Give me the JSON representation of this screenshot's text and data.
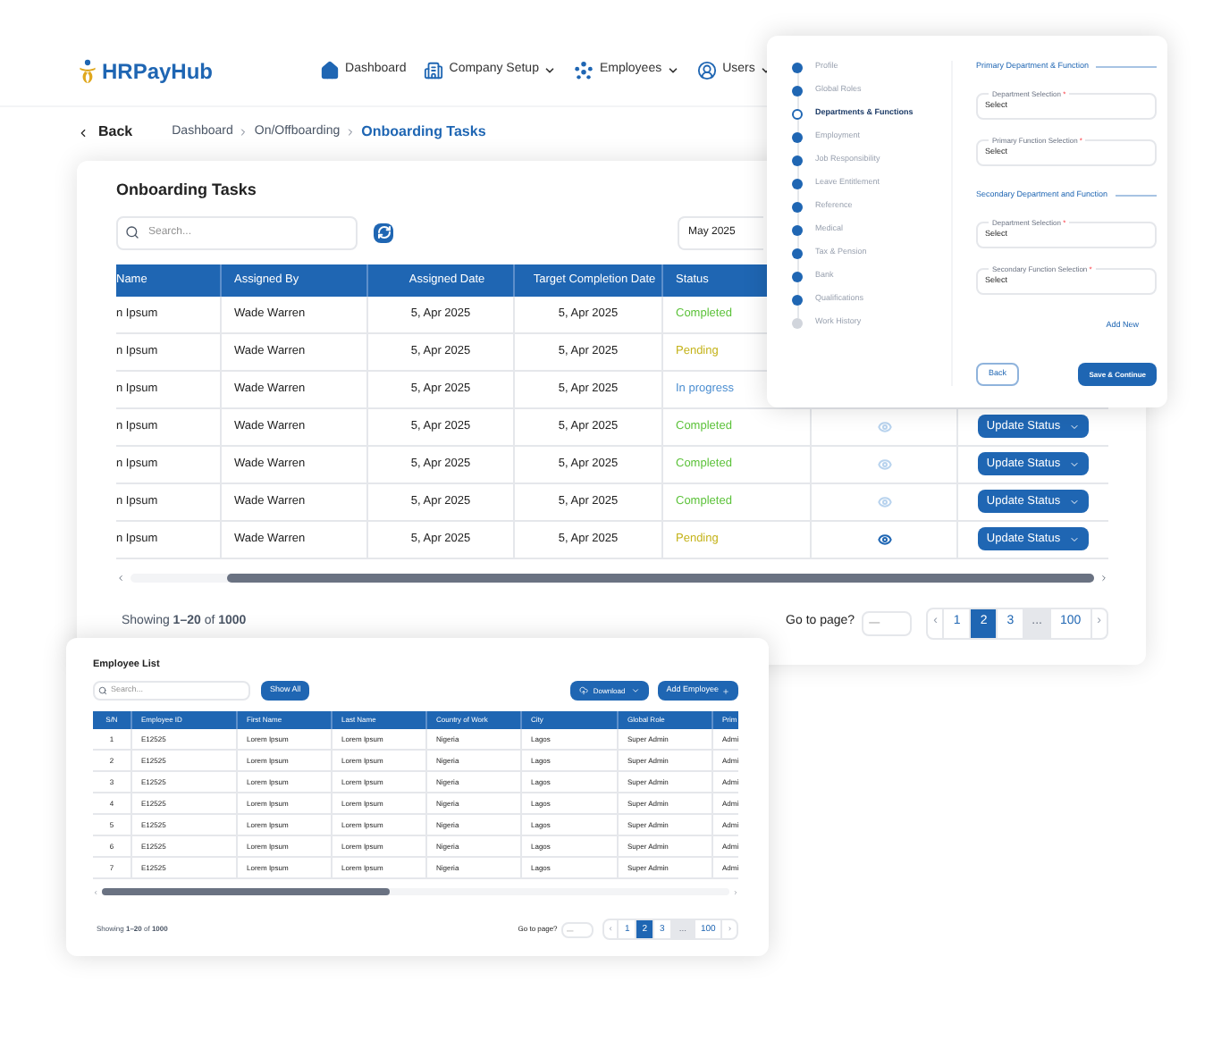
{
  "header": {
    "logo": "HRPayHub",
    "nav": [
      {
        "label": "Dashboard",
        "dropdown": false
      },
      {
        "label": "Company Setup",
        "dropdown": true
      },
      {
        "label": "Employees",
        "dropdown": true
      },
      {
        "label": "Users",
        "dropdown": true
      }
    ]
  },
  "breadcrumb": {
    "back": "Back",
    "items": [
      {
        "label": "Dashboard",
        "selected": false
      },
      {
        "label": "On/Offboarding",
        "selected": false
      },
      {
        "label": "Onboarding Tasks",
        "selected": true
      }
    ]
  },
  "onboarding": {
    "title": "Onboarding Tasks",
    "search_placeholder": "Search...",
    "month": "May 2025",
    "columns": [
      "Name",
      "Assigned By",
      "Assigned Date",
      "Target Completion Date",
      "Status"
    ],
    "rows": [
      {
        "name": "n Ipsum",
        "assigned_by": "Wade Warren",
        "assigned_date": "5, Apr 2025",
        "target_date": "5, Apr 2025",
        "status": "Completed",
        "kind": "completed"
      },
      {
        "name": "n Ipsum",
        "assigned_by": "Wade Warren",
        "assigned_date": "5, Apr 2025",
        "target_date": "5, Apr 2025",
        "status": "Pending",
        "kind": "pending"
      },
      {
        "name": "n Ipsum",
        "assigned_by": "Wade Warren",
        "assigned_date": "5, Apr 2025",
        "target_date": "5, Apr 2025",
        "status": "In progress",
        "kind": "progress"
      },
      {
        "name": "n Ipsum",
        "assigned_by": "Wade Warren",
        "assigned_date": "5, Apr 2025",
        "target_date": "5, Apr 2025",
        "status": "Completed",
        "kind": "completed",
        "eye_active": false,
        "action": "Update Status"
      },
      {
        "name": "n Ipsum",
        "assigned_by": "Wade Warren",
        "assigned_date": "5, Apr 2025",
        "target_date": "5, Apr 2025",
        "status": "Completed",
        "kind": "completed",
        "eye_active": false,
        "action": "Update Status"
      },
      {
        "name": "n Ipsum",
        "assigned_by": "Wade Warren",
        "assigned_date": "5, Apr 2025",
        "target_date": "5, Apr 2025",
        "status": "Completed",
        "kind": "completed",
        "eye_active": false,
        "action": "Update Status"
      },
      {
        "name": "n Ipsum",
        "assigned_by": "Wade Warren",
        "assigned_date": "5, Apr 2025",
        "target_date": "5, Apr 2025",
        "status": "Pending",
        "kind": "pending",
        "eye_active": true,
        "action": "Update Status"
      }
    ],
    "showing": "Showing **1–20** of **1000**",
    "goto_label": "Go to page?",
    "goto_placeholder": "—",
    "pages": [
      {
        "label": "‹",
        "kind": "arrow",
        "selected": false
      },
      {
        "label": "1",
        "kind": "page",
        "selected": false
      },
      {
        "label": "2",
        "kind": "page",
        "selected": true
      },
      {
        "label": "3",
        "kind": "page",
        "selected": false
      },
      {
        "label": "...",
        "kind": "gap",
        "selected": false
      },
      {
        "label": "100",
        "kind": "page",
        "selected": false
      },
      {
        "label": "›",
        "kind": "arrow",
        "selected": false
      }
    ]
  },
  "form": {
    "steps": [
      {
        "label": "Profile",
        "kind": "done"
      },
      {
        "label": "Global Roles",
        "kind": "done"
      },
      {
        "label": "Departments & Functions",
        "kind": "current"
      },
      {
        "label": "Employment",
        "kind": "done"
      },
      {
        "label": "Job Responsibility",
        "kind": "done"
      },
      {
        "label": "Leave Entitlement",
        "kind": "done"
      },
      {
        "label": "Reference",
        "kind": "done"
      },
      {
        "label": "Medical",
        "kind": "done"
      },
      {
        "label": "Tax & Pension",
        "kind": "done"
      },
      {
        "label": "Bank",
        "kind": "done"
      },
      {
        "label": "Qualifications",
        "kind": "done"
      },
      {
        "label": "Work History",
        "kind": "todo"
      }
    ],
    "sections": [
      {
        "title": "Primary Department & Function",
        "fields": [
          {
            "label": "Department Selection",
            "required_mark": "*",
            "value": "Select"
          },
          {
            "label": "Primary Function Selection",
            "required_mark": "*",
            "value": "Select"
          }
        ]
      },
      {
        "title": "Secondary Department and Function",
        "fields": [
          {
            "label": "Department Selection",
            "required_mark": "*",
            "value": "Select"
          },
          {
            "label": "Secondary Function Selection",
            "required_mark": "*",
            "value": "Select"
          }
        ]
      }
    ],
    "add_new": "Add New",
    "back": "Back",
    "save": "Save & Continue"
  },
  "employees": {
    "title": "Employee List",
    "search_placeholder": "Search...",
    "show_all": "Show All",
    "download": "Download",
    "add": "Add Employee",
    "columns": [
      "S/N",
      "Employee ID",
      "First Name",
      "Last Name",
      "Country of Work",
      "City",
      "Global Role",
      "Prim"
    ],
    "rows": [
      [
        "1",
        "E12525",
        "Lorem Ipsum",
        "Lorem Ipsum",
        "Nigeria",
        "Lagos",
        "Super Admin",
        "Admi"
      ],
      [
        "2",
        "E12525",
        "Lorem Ipsum",
        "Lorem Ipsum",
        "Nigeria",
        "Lagos",
        "Super Admin",
        "Admi"
      ],
      [
        "3",
        "E12525",
        "Lorem Ipsum",
        "Lorem Ipsum",
        "Nigeria",
        "Lagos",
        "Super Admin",
        "Admi"
      ],
      [
        "4",
        "E12525",
        "Lorem Ipsum",
        "Lorem Ipsum",
        "Nigeria",
        "Lagos",
        "Super Admin",
        "Admi"
      ],
      [
        "5",
        "E12525",
        "Lorem Ipsum",
        "Lorem Ipsum",
        "Nigeria",
        "Lagos",
        "Super Admin",
        "Admi"
      ],
      [
        "6",
        "E12525",
        "Lorem Ipsum",
        "Lorem Ipsum",
        "Nigeria",
        "Lagos",
        "Super Admin",
        "Admi"
      ],
      [
        "7",
        "E12525",
        "Lorem Ipsum",
        "Lorem Ipsum",
        "Nigeria",
        "Lagos",
        "Super Admin",
        "Admi"
      ]
    ],
    "showing": "Showing **1–20** of **1000**",
    "goto_label": "Go to page?",
    "goto_placeholder": "—",
    "pages": [
      {
        "label": "‹",
        "kind": "arrow",
        "selected": false
      },
      {
        "label": "1",
        "kind": "page",
        "selected": false
      },
      {
        "label": "2",
        "kind": "page",
        "selected": true
      },
      {
        "label": "3",
        "kind": "page",
        "selected": false
      },
      {
        "label": "...",
        "kind": "gap",
        "selected": false
      },
      {
        "label": "100",
        "kind": "page",
        "selected": false
      },
      {
        "label": "›",
        "kind": "arrow",
        "selected": false
      }
    ]
  }
}
